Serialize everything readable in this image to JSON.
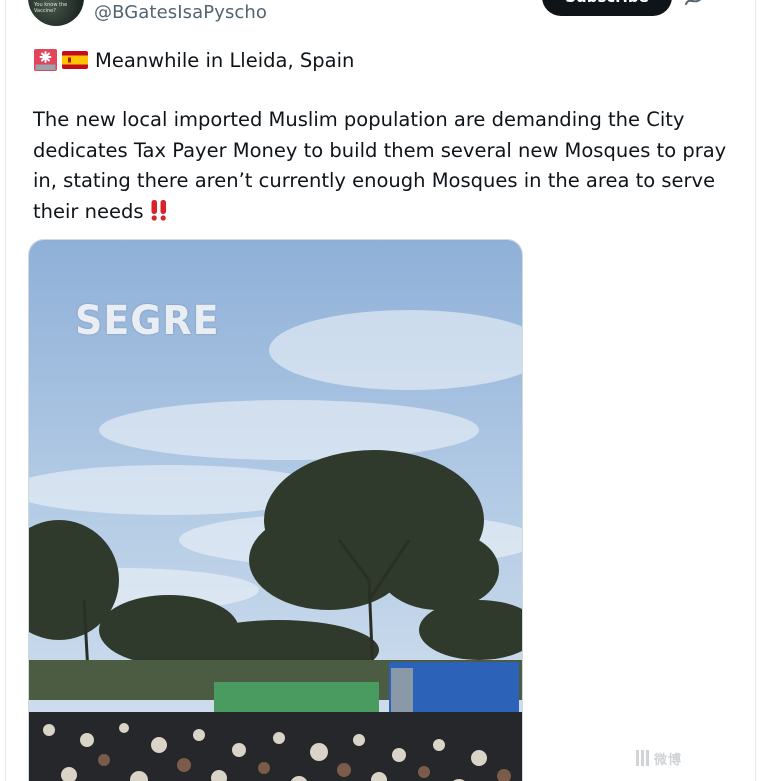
{
  "tweet": {
    "handle": "@BGatesIsaPyscho",
    "avatar_text": "You know the Vaccine?",
    "subscribe_label": "Subscribe",
    "headline": "Meanwhile in Lleida, Spain",
    "body": "The new local imported Muslim population are demanding the City dedicates Tax Payer Money to build them several new Mosques to pray in, stating there aren’t currently enough Mosques in the area to serve their needs",
    "icons": {
      "siren": "police-light-icon",
      "flag": "spain-flag-icon",
      "emphasis": "double-exclamation-icon",
      "more": "more-icon"
    }
  },
  "media": {
    "watermark": "SEGRE"
  },
  "site_watermark": {
    "text": "微博"
  },
  "colors": {
    "text": "#0f1419",
    "secondary": "#536471",
    "accent_red": "#e0245e"
  }
}
